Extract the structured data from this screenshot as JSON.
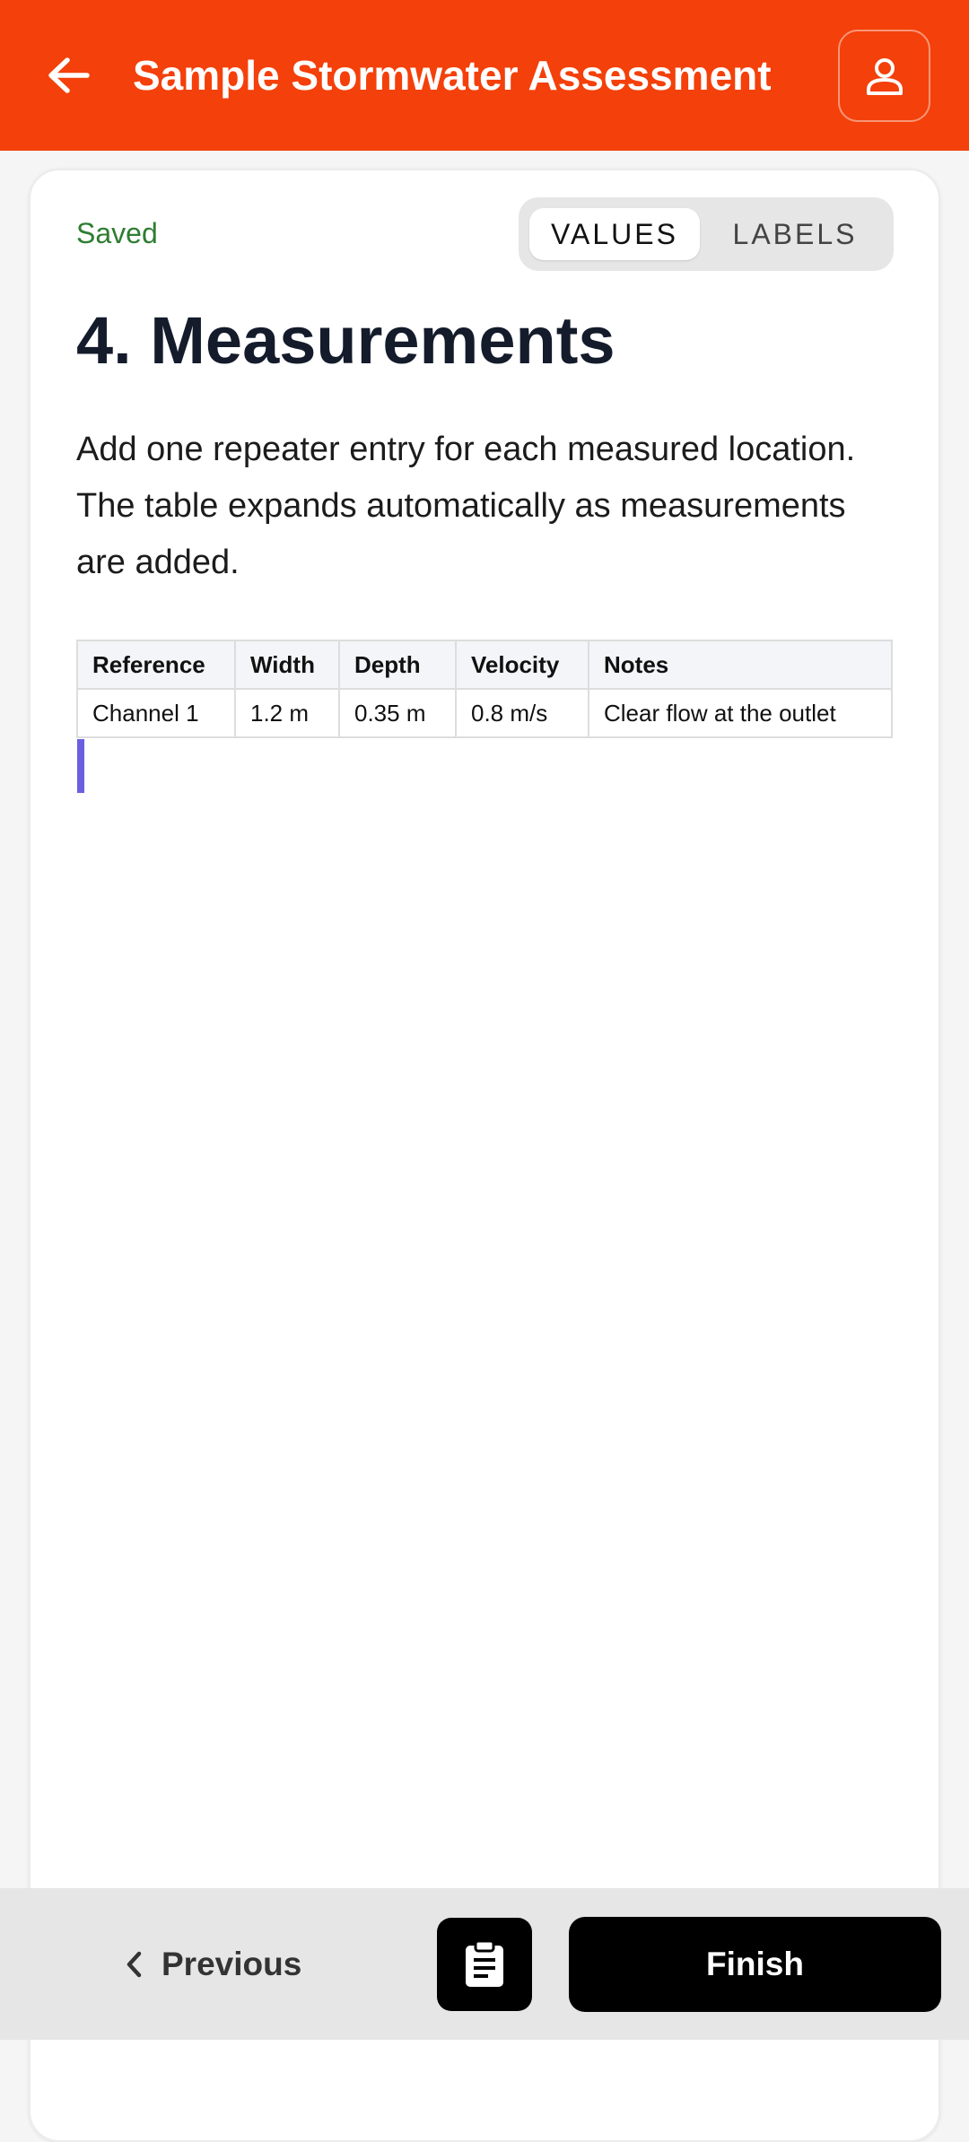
{
  "colors": {
    "header_bg": "#f4400a",
    "saved": "#2e7d32",
    "accent_cursor": "#6b5fe0",
    "primary_button": "#000000"
  },
  "header": {
    "back_icon": "arrow-left-icon",
    "title": "Sample Stormwater Assessment",
    "profile_icon": "user-icon"
  },
  "status": {
    "saved_label": "Saved"
  },
  "view_toggle": {
    "options": [
      "VALUES",
      "LABELS"
    ],
    "selected": "VALUES"
  },
  "section": {
    "title": "4. Measurements",
    "description": "Add one repeater entry for each measured location. The table expands automatically as measurements are added."
  },
  "table": {
    "headers": [
      "Reference",
      "Width",
      "Depth",
      "Velocity",
      "Notes"
    ],
    "rows": [
      [
        "Channel 1",
        "1.2 m",
        "0.35 m",
        "0.8 m/s",
        "Clear flow at the outlet"
      ]
    ]
  },
  "footer": {
    "previous_label": "Previous",
    "previous_icon": "chevron-left-icon",
    "notes_icon": "clipboard-icon",
    "finish_label": "Finish"
  }
}
